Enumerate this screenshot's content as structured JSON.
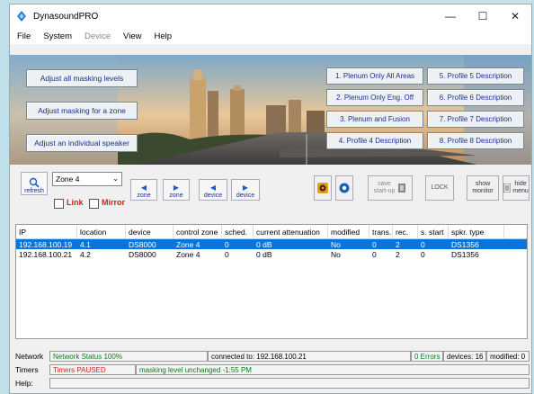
{
  "window": {
    "title": "DynasoundPRO",
    "minimize": "—",
    "maximize": "☐",
    "close": "✕"
  },
  "menu": [
    "File",
    "System",
    "Device",
    "View",
    "Help"
  ],
  "banner": {
    "left_buttons": [
      "Adjust all masking levels",
      "Adjust masking for a zone",
      "Adjust an individual speaker"
    ],
    "profiles_col1": [
      "1. Plenum Only All Areas",
      "2. Plenum Only Eng. Off",
      "3. Plenum and Fusion",
      "4. Profile 4 Description"
    ],
    "profiles_col2": [
      "5. Profile 5 Description",
      "6. Profile 6 Description",
      "7. Profile 7 Description",
      "8. Profile 8 Description"
    ]
  },
  "toolbar": {
    "refresh": "refresh",
    "zone_value": "Zone 4",
    "link": "Link",
    "mirror": "Mirror",
    "zone_btn_1": "zone",
    "zone_btn_2": "zone",
    "device_btn_1": "device",
    "device_btn_2": "device",
    "save_line1": "save",
    "save_line2": "start-up",
    "lock": "LOCK",
    "show_line1": "show",
    "show_line2": "monitor",
    "hide_line1": "hide",
    "hide_line2": "menu"
  },
  "table": {
    "headers": [
      "IP",
      "location",
      "device",
      "control zone",
      "sched.",
      "current attenuation",
      "modified",
      "trans.",
      "rec.",
      "s. start",
      "spkr. type"
    ],
    "rows": [
      [
        "192.168.100.19",
        "4.1",
        "DS8000",
        "Zone 4",
        "0",
        "0 dB",
        "No",
        "0",
        "2",
        "0",
        "DS1356"
      ],
      [
        "192.168.100.21",
        "4.2",
        "DS8000",
        "Zone 4",
        "0",
        "0 dB",
        "No",
        "0",
        "2",
        "0",
        "DS1356"
      ]
    ]
  },
  "status": {
    "network_label": "Network",
    "network_status": "Network Status 100%",
    "connected": "connected to: 192.168.100.21",
    "errors": "0 Errors",
    "devices": "devices: 16",
    "modified": "modified: 0",
    "timers_label": "Timers",
    "timers_status": "Timers PAUSED",
    "masking_msg": "masking level unchanged -1:55 PM",
    "help_label": "Help:"
  },
  "colors": {
    "accent": "#0a74da",
    "button_text": "#1b2f8f",
    "warn": "#d42020",
    "ok": "#0b7a1a"
  }
}
